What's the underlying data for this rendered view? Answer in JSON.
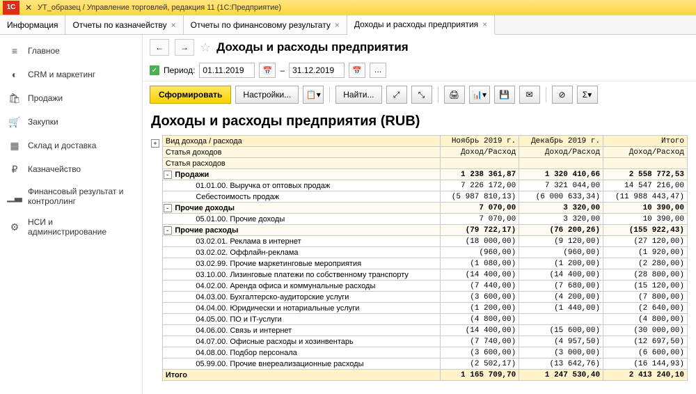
{
  "titlebar": {
    "app": "УТ_образец / Управление торговлей, редакция 11  (1С:Предприятие)",
    "logo": "1C"
  },
  "tabs": [
    {
      "label": "Информация"
    },
    {
      "label": "Отчеты по казначейству"
    },
    {
      "label": "Отчеты по финансовому результату"
    },
    {
      "label": "Доходы и расходы предприятия",
      "active": true
    }
  ],
  "sidebar": [
    {
      "icon": "≡",
      "label": "Главное"
    },
    {
      "icon": "◐",
      "label": "CRM и маркетинг"
    },
    {
      "icon": "🛍",
      "label": "Продажи"
    },
    {
      "icon": "🛒",
      "label": "Закупки"
    },
    {
      "icon": "▦",
      "label": "Склад и доставка"
    },
    {
      "icon": "₽",
      "label": "Казначейство"
    },
    {
      "icon": "▁▃",
      "label": "Финансовый результат и контроллинг"
    },
    {
      "icon": "⚙",
      "label": "НСИ и администрирование"
    }
  ],
  "header": {
    "page_title": "Доходы и расходы предприятия"
  },
  "period": {
    "label": "Период:",
    "from": "01.11.2019",
    "to": "31.12.2019",
    "dash": "–"
  },
  "toolbar": {
    "run": "Сформировать",
    "settings": "Настройки...",
    "find": "Найти..."
  },
  "report": {
    "title": "Доходы и расходы предприятия (RUB)",
    "columns": {
      "c0": "Вид дохода / расхода",
      "c0a": "Статья доходов",
      "c0b": "Статья расходов",
      "c1": "Ноябрь 2019 г.",
      "c2": "Декабрь 2019 г.",
      "c3": "Итого",
      "sub": "Доход/Расход"
    },
    "rows": [
      {
        "exp": "-",
        "label": "Продажи",
        "bold": true,
        "v": [
          "1 238 361,87",
          "1 320 410,66",
          "2 558 772,53"
        ]
      },
      {
        "indent": 2,
        "label": "01.01.00. Выручка от оптовых продаж",
        "v": [
          "7 226 172,00",
          "7 321 044,00",
          "14 547 216,00"
        ]
      },
      {
        "indent": 2,
        "label": "Себестоимость продаж",
        "neg": true,
        "v": [
          "5 987 810,13",
          "6 000 633,34",
          "11 988 443,47"
        ]
      },
      {
        "exp": "-",
        "label": "Прочие доходы",
        "bold": true,
        "v": [
          "7 070,00",
          "3 320,00",
          "10 390,00"
        ]
      },
      {
        "indent": 2,
        "label": "05.01.00. Прочие доходы",
        "v": [
          "7 070,00",
          "3 320,00",
          "10 390,00"
        ]
      },
      {
        "exp": "-",
        "label": "Прочие расходы",
        "bold": true,
        "neg": true,
        "v": [
          "79 722,17",
          "76 200,26",
          "155 922,43"
        ]
      },
      {
        "indent": 2,
        "label": "03.02.01. Реклама в интернет",
        "neg": true,
        "v": [
          "18 000,00",
          "9 120,00",
          "27 120,00"
        ]
      },
      {
        "indent": 2,
        "label": "03.02.02. Оффлайн-реклама",
        "neg": true,
        "v": [
          "960,00",
          "960,00",
          "1 920,00"
        ]
      },
      {
        "indent": 2,
        "label": "03.02.99. Прочие маркетинговые мероприятия",
        "neg": true,
        "v": [
          "1 080,00",
          "1 200,00",
          "2 280,00"
        ]
      },
      {
        "indent": 2,
        "label": "03.10.00. Лизинговые платежи по собственному транспорту",
        "neg": true,
        "v": [
          "14 400,00",
          "14 400,00",
          "28 800,00"
        ]
      },
      {
        "indent": 2,
        "label": "04.02.00. Аренда офиса и коммунальные расходы",
        "neg": true,
        "v": [
          "7 440,00",
          "7 680,00",
          "15 120,00"
        ]
      },
      {
        "indent": 2,
        "label": "04.03.00. Бухгалтерско-аудиторские услуги",
        "neg": true,
        "v": [
          "3 600,00",
          "4 200,00",
          "7 800,00"
        ]
      },
      {
        "indent": 2,
        "label": "04.04.00. Юридически и нотариальные услуги",
        "neg": true,
        "v": [
          "1 200,00",
          "1 440,00",
          "2 640,00"
        ]
      },
      {
        "indent": 2,
        "label": "04.05.00. ПО и IT-услуги",
        "neg": true,
        "v": [
          "4 800,00",
          "",
          "4 800,00"
        ]
      },
      {
        "indent": 2,
        "label": "04.06.00. Связь и интернет",
        "neg": true,
        "v": [
          "14 400,00",
          "15 600,00",
          "30 000,00"
        ]
      },
      {
        "indent": 2,
        "label": "04.07.00. Офисные расходы и хозинвентарь",
        "neg": true,
        "v": [
          "7 740,00",
          "4 957,50",
          "12 697,50"
        ]
      },
      {
        "indent": 2,
        "label": "04.08.00. Подбор персонала",
        "neg": true,
        "v": [
          "3 600,00",
          "3 000,00",
          "6 600,00"
        ]
      },
      {
        "indent": 2,
        "label": "05.99.00. Прочие внереализационные расходы",
        "neg": true,
        "v": [
          "2 502,17",
          "13 642,76",
          "16 144,93"
        ]
      }
    ],
    "total": {
      "label": "Итого",
      "v": [
        "1 165 709,70",
        "1 247 530,40",
        "2 413 240,10"
      ]
    }
  }
}
